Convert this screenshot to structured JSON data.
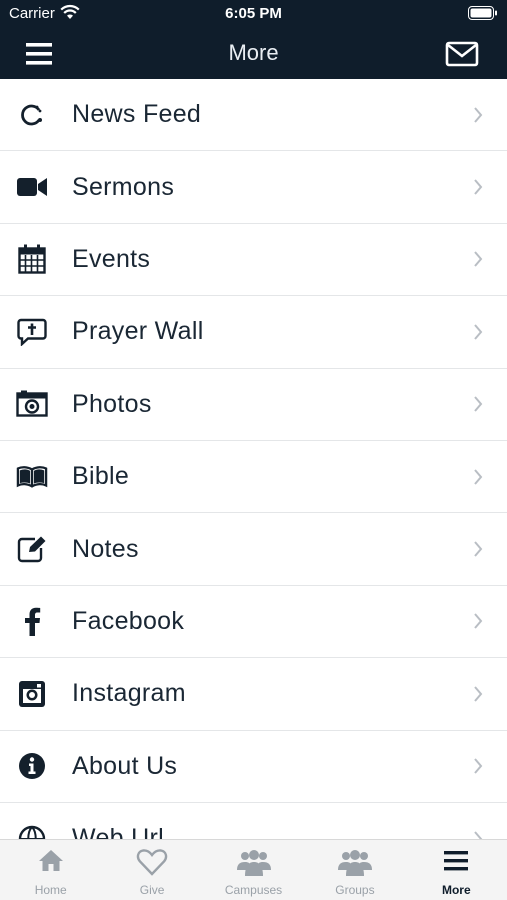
{
  "status": {
    "carrier": "Carrier",
    "time": "6:05 PM"
  },
  "header": {
    "title": "More"
  },
  "menu": [
    {
      "label": "News Feed",
      "icon": "news-feed-icon"
    },
    {
      "label": "Sermons",
      "icon": "video-camera-icon"
    },
    {
      "label": "Events",
      "icon": "calendar-icon"
    },
    {
      "label": "Prayer Wall",
      "icon": "prayer-bubble-icon"
    },
    {
      "label": "Photos",
      "icon": "camera-icon"
    },
    {
      "label": "Bible",
      "icon": "bible-book-icon"
    },
    {
      "label": "Notes",
      "icon": "notes-edit-icon"
    },
    {
      "label": "Facebook",
      "icon": "facebook-icon"
    },
    {
      "label": "Instagram",
      "icon": "instagram-icon"
    },
    {
      "label": "About Us",
      "icon": "info-icon"
    },
    {
      "label": "Web Url",
      "icon": "globe-icon"
    }
  ],
  "tabs": [
    {
      "label": "Home",
      "icon": "home-icon"
    },
    {
      "label": "Give",
      "icon": "heart-icon"
    },
    {
      "label": "Campuses",
      "icon": "people-icon"
    },
    {
      "label": "Groups",
      "icon": "people-icon"
    },
    {
      "label": "More",
      "icon": "hamburger-icon",
      "active": true
    }
  ],
  "colors": {
    "header_bg": "#0f1d2b",
    "icon_dark": "#14202c",
    "chevron": "#b9bec4",
    "tab_inactive": "#9aa1a8"
  }
}
